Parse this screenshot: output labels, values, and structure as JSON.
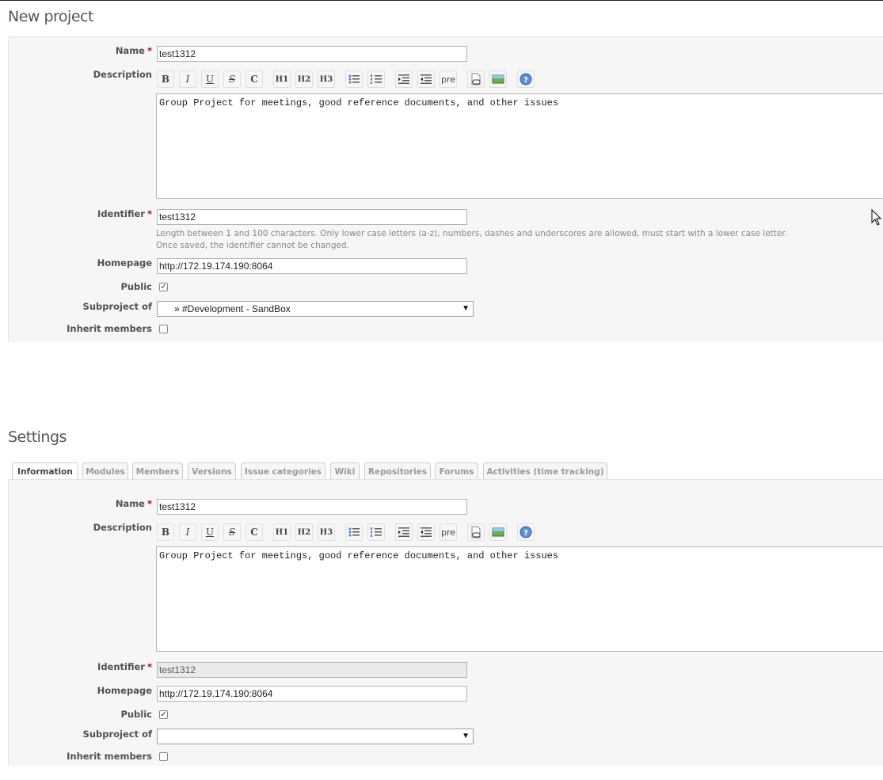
{
  "new_project": {
    "title": "New project",
    "name_label": "Name",
    "name_value": "test1312",
    "description_label": "Description",
    "description_value": "Group Project for meetings, good reference documents, and other issues",
    "identifier_label": "Identifier",
    "identifier_value": "test1312",
    "identifier_hint_1": "Length between 1 and 100 characters. Only lower case letters (a-z), numbers, dashes and underscores are allowed, must start with a lower case letter.",
    "identifier_hint_2": "Once saved, the identifier cannot be changed.",
    "homepage_label": "Homepage",
    "homepage_value": "http://172.19.174.190:8064",
    "public_label": "Public",
    "public_checked": true,
    "subproject_label": "Subproject of",
    "subproject_value": "» #Development - SandBox",
    "inherit_label": "Inherit members",
    "inherit_checked": false
  },
  "toolbar": {
    "bold": "B",
    "italic": "I",
    "underline": "U",
    "strike": "S",
    "code": "C",
    "h1": "H1",
    "h2": "H2",
    "h3": "H3",
    "pre": "pre"
  },
  "required_mark": "*",
  "settings": {
    "title": "Settings",
    "tabs": [
      {
        "label": "Information",
        "active": true
      },
      {
        "label": "Modules"
      },
      {
        "label": "Members"
      },
      {
        "label": "Versions"
      },
      {
        "label": "Issue categories"
      },
      {
        "label": "Wiki"
      },
      {
        "label": "Repositories"
      },
      {
        "label": "Forums"
      },
      {
        "label": "Activities (time tracking)"
      }
    ],
    "name_label": "Name",
    "name_value": "test1312",
    "description_label": "Description",
    "description_value": "Group Project for meetings, good reference documents, and other issues",
    "identifier_label": "Identifier",
    "identifier_value": "test1312",
    "homepage_label": "Homepage",
    "homepage_value": "http://172.19.174.190:8064",
    "public_label": "Public",
    "public_checked": true,
    "subproject_label": "Subproject of",
    "subproject_value": "",
    "inherit_label": "Inherit members",
    "inherit_checked": false
  },
  "colors": {
    "required": "#bb0000",
    "panel_bg": "#f6f6f6",
    "heading": "#555555"
  }
}
